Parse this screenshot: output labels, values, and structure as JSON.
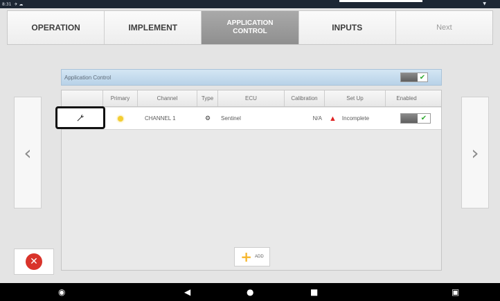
{
  "status_bar": {
    "time": "8:31"
  },
  "tabs": [
    {
      "label": "OPERATION",
      "state": "normal"
    },
    {
      "label": "IMPLEMENT",
      "state": "normal"
    },
    {
      "label": "APPLICATION CONTROL",
      "state": "active"
    },
    {
      "label": "INPUTS",
      "state": "normal"
    },
    {
      "label": "Next",
      "state": "disabled"
    }
  ],
  "panel": {
    "title": "Application Control",
    "enabled": true
  },
  "table": {
    "headers": [
      "",
      "Primary",
      "Channel",
      "Type",
      "ECU",
      "Calibration",
      "Set Up",
      "Enabled"
    ],
    "rows": [
      {
        "primary_icon": "sun-icon",
        "channel": "CHANNEL 1",
        "type_icon": "gear-icon",
        "ecu": "Sentinel",
        "calibration": "N/A",
        "setup_icon": "warning-icon",
        "setup": "Incomplete",
        "enabled": true
      }
    ]
  },
  "add_button": {
    "label": "ADD"
  },
  "colors": {
    "active_tab": "#999999",
    "header_blue": "#c5dced",
    "warning": "#e02424",
    "close": "#d9342b",
    "add": "#f6b62d",
    "check": "#2faa2f"
  }
}
